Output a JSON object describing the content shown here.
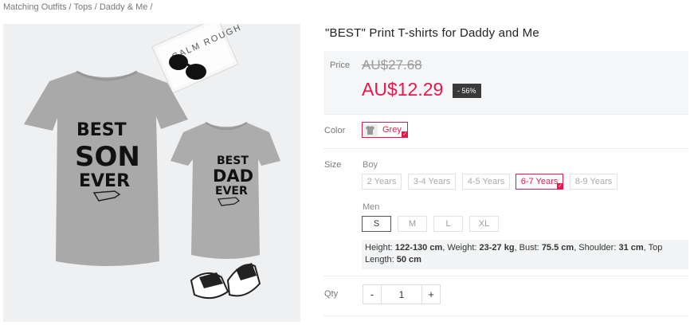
{
  "breadcrumb": "Matching Outfits / Tops / Daddy & Me /",
  "product": {
    "title": "\"BEST\" Print T-shirts for Daddy and Me",
    "shirt_big_text": [
      "BEST",
      "SON",
      "EVER"
    ],
    "shirt_small_text": [
      "BEST",
      "DAD",
      "EVER"
    ],
    "notebook_text": "CALM ROUGH"
  },
  "price": {
    "label": "Price",
    "original": "AU$27.68",
    "sale": "AU$12.29",
    "discount": "- 56%"
  },
  "color": {
    "label": "Color",
    "selected": "Grey"
  },
  "size": {
    "label": "Size",
    "boy_label": "Boy",
    "boy_options": [
      "2 Years",
      "3-4 Years",
      "4-5 Years",
      "6-7 Years",
      "8-9 Years"
    ],
    "men_label": "Men",
    "men_options": [
      "S",
      "M",
      "L",
      "XL"
    ]
  },
  "size_info": {
    "height_label": "Height:",
    "height": "122-130 cm",
    "weight_label": ", Weight:",
    "weight": "23-27 kg",
    "bust_label": ", Bust:",
    "bust": "75.5 cm",
    "shoulder_label": ", Shoulder:",
    "shoulder": "31 cm",
    "top_length_label": ", Top Length:",
    "top_length": "50 cm"
  },
  "qty": {
    "label": "Qty",
    "minus": "-",
    "value": "1",
    "plus": "+"
  },
  "colors": {
    "accent": "#e8174b",
    "price_bg": "#f5f6f7",
    "badge_bg": "#3a3a3a"
  }
}
